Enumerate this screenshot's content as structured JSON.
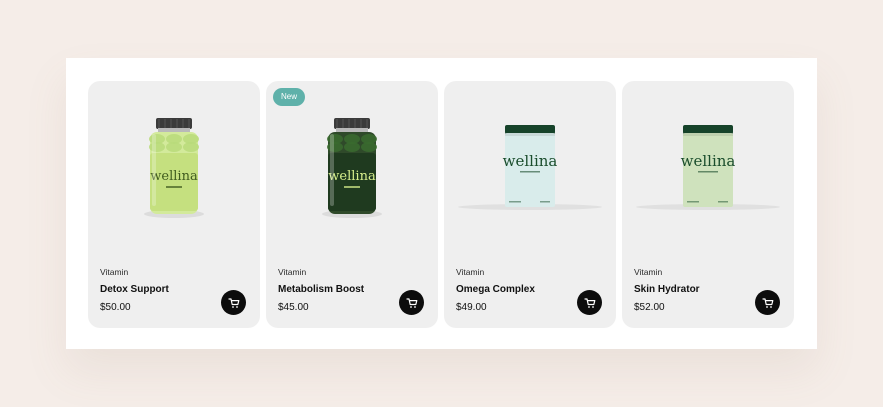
{
  "products": [
    {
      "category": "Vitamin",
      "name": "Detox Support",
      "price": "$50.00",
      "badge": "",
      "brand_label": "wellina",
      "package": "bottle",
      "colors": {
        "body": "#d3ea9b",
        "label": "#c5e07f",
        "text": "#3f5a1e",
        "pills": "#b9db7a"
      }
    },
    {
      "category": "Vitamin",
      "name": "Metabolism Boost",
      "price": "$45.00",
      "badge": "New",
      "brand_label": "wellina",
      "package": "bottle",
      "colors": {
        "body": "#2f4a2a",
        "label": "#1f3a1f",
        "text": "#d7ef8c",
        "pills": "#3a6b2f"
      }
    },
    {
      "category": "Vitamin",
      "name": "Omega Complex",
      "price": "$49.00",
      "badge": "",
      "brand_label": "wellina",
      "package": "tub",
      "colors": {
        "body": "#d9eceb",
        "lid": "#16432a",
        "text": "#1a4d2c"
      }
    },
    {
      "category": "Vitamin",
      "name": "Skin Hydrator",
      "price": "$52.00",
      "badge": "",
      "brand_label": "wellina",
      "package": "tub",
      "colors": {
        "body": "#cfe2bd",
        "lid": "#16432a",
        "text": "#1a4d2c"
      }
    }
  ],
  "cart_icon": "cart-icon",
  "accent_colors": {
    "badge": "#5fb1aa",
    "cart_button": "#0c0c0c"
  }
}
